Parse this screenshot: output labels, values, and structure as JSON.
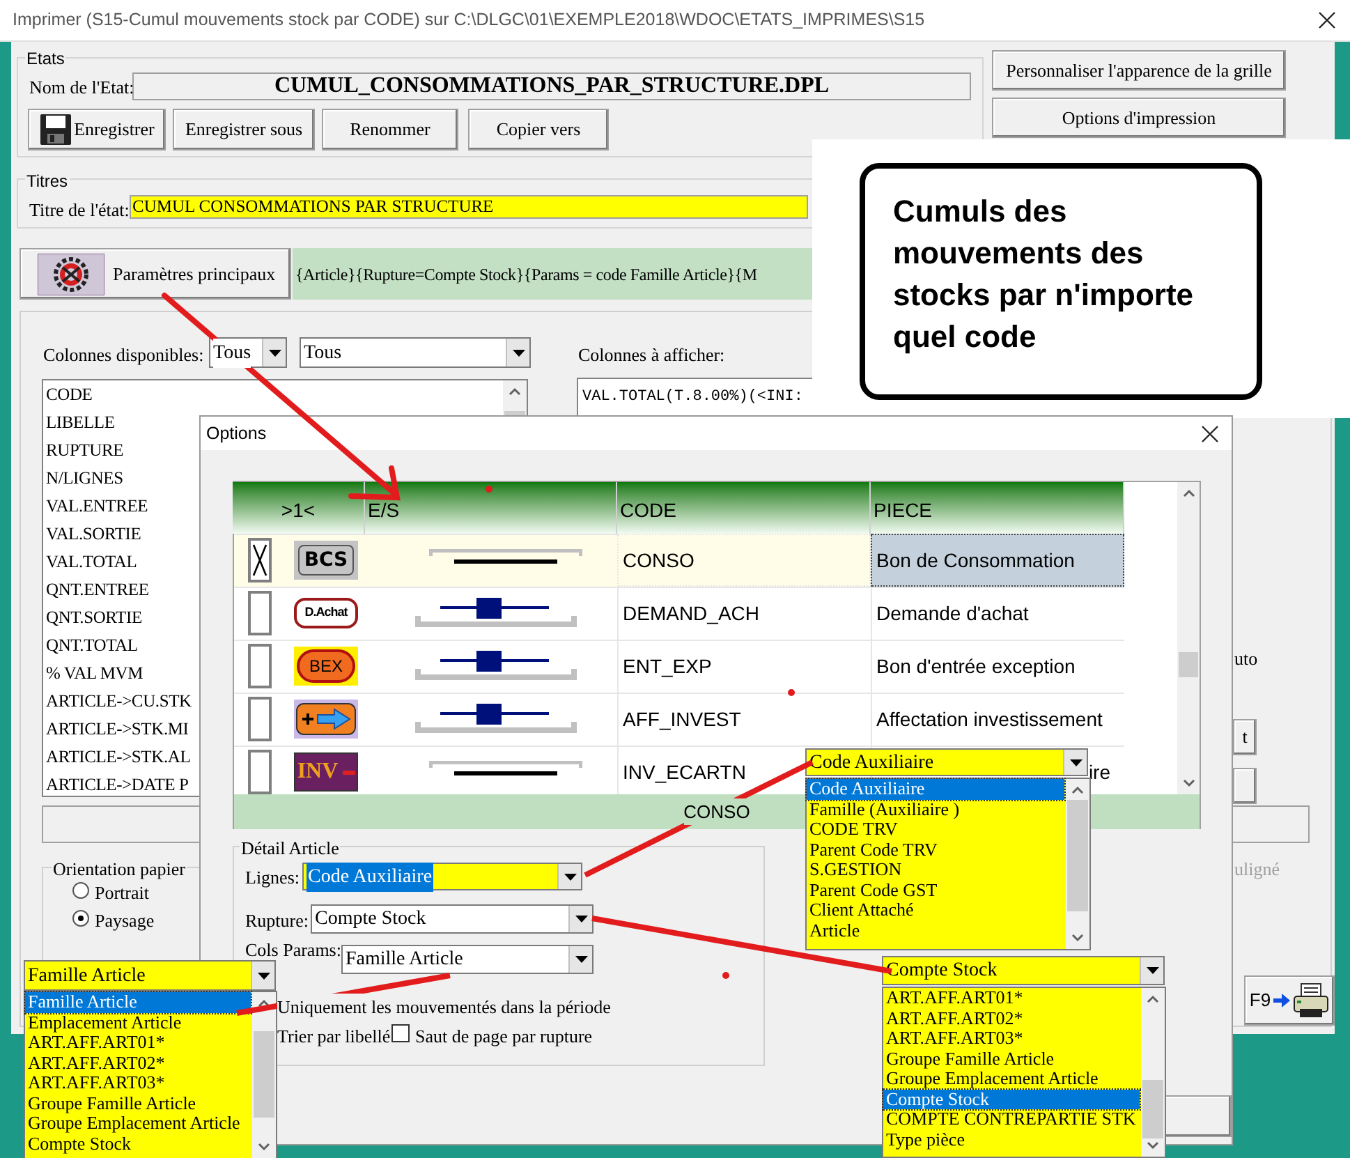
{
  "window": {
    "title": "Imprimer (S15-Cumul mouvements stock par CODE)  sur C:\\DLGC\\01\\EXEMPLE2018\\WDOC\\ETATS_IMPRIMES\\S15"
  },
  "etats": {
    "label": "Etats",
    "name_label": "Nom de l'Etat:",
    "name": "CUMUL_CONSOMMATIONS_PAR_STRUCTURE.DPL",
    "buttons": [
      {
        "label": "Enregistrer",
        "kind": "save"
      },
      {
        "label": "Enregistrer sous",
        "kind": "plain"
      },
      {
        "label": "Renommer",
        "kind": "plain"
      },
      {
        "label": "Copier vers",
        "kind": "plain"
      }
    ]
  },
  "side_buttons": [
    "Personnaliser l'apparence de la grille",
    "Options d'impression"
  ],
  "titres": {
    "label": "Titres",
    "title_label": "Titre de l'état:",
    "title": "CUMUL CONSOMMATIONS PAR STRUCTURE"
  },
  "params": {
    "button": "Paramètres principaux",
    "summary": "{Article}{Rupture=Compte Stock}{Params = code Famille Article}{M"
  },
  "callout": "Cumuls des mouvements des stocks par n'importe quel code",
  "columns": {
    "available_label": "Colonnes disponibles:",
    "filter_1": "Tous",
    "filter_2": "Tous",
    "display_label": "Colonnes à afficher:",
    "available": [
      "CODE",
      "LIBELLE",
      "RUPTURE",
      "N/LIGNES",
      "VAL.ENTREE",
      "VAL.SORTIE",
      "VAL.TOTAL",
      "QNT.ENTREE",
      "QNT.SORTIE",
      "QNT.TOTAL",
      "% VAL MVM",
      "ARTICLE->CU.STK",
      "ARTICLE->STK.MI",
      "ARTICLE->STK.AL",
      "ARTICLE->DATE P"
    ],
    "displayed": [
      "VAL.TOTAL(T.8.00%)(<INI:"
    ]
  },
  "orientation": {
    "label": "Orientation papier",
    "options": [
      {
        "label": "Portrait",
        "selected": false
      },
      {
        "label": "Paysage",
        "selected": true
      }
    ]
  },
  "right_edge": [
    {
      "kind": "text",
      "text": "uto"
    },
    {
      "kind": "button",
      "text": "t"
    },
    {
      "kind": "disabled",
      "text": "uligné"
    }
  ],
  "print_button": {
    "label": "F9"
  },
  "options_dialog": {
    "title": "Options",
    "grid": {
      "columns": [
        ">1<",
        "E/S",
        "CODE",
        "PIECE"
      ],
      "rows": [
        {
          "checked": true,
          "selected": true,
          "kind": "bcs",
          "badge_text": "BCS",
          "es_slider": false,
          "code": "CONSO",
          "piece": "Bon de Consommation"
        },
        {
          "checked": false,
          "selected": false,
          "kind": "dachat",
          "badge_text": "D.Achat",
          "es_slider": true,
          "code": "DEMAND_ACH",
          "piece": "Demande d'achat"
        },
        {
          "checked": false,
          "selected": false,
          "kind": "bex",
          "badge_text": "BEX",
          "es_slider": true,
          "code": "ENT_EXP",
          "piece": "Bon d'entrée exception"
        },
        {
          "checked": false,
          "selected": false,
          "kind": "aff",
          "es_slider": true,
          "code": "AFF_INVEST",
          "piece": "Affectation investissement"
        },
        {
          "checked": false,
          "selected": false,
          "kind": "inv",
          "badge_text": "INV",
          "es_slider": false,
          "code": "INV_ECARTN",
          "piece": "ire"
        }
      ],
      "footer": "CONSO"
    },
    "detail": {
      "label": "Détail Article",
      "fields": [
        {
          "label": "Lignes:",
          "value": "Code Auxiliaire",
          "highlighted": true
        },
        {
          "label": "Rupture:",
          "value": "Compte Stock",
          "highlighted": false
        },
        {
          "label": "Cols Params:",
          "value": "Famille Article",
          "highlighted": false
        }
      ],
      "checks": [
        {
          "label": "Uniquement les mouvementés dans la période"
        },
        {
          "label": "Trier par libellé"
        },
        {
          "label": "Saut de page par rupture",
          "checked": false
        }
      ]
    }
  },
  "open_lists": [
    {
      "value": "Code Auxiliaire",
      "items": [
        {
          "label": "Code Auxiliaire",
          "selected": true
        },
        {
          "label": "Famille (Auxiliaire )",
          "selected": false
        },
        {
          "label": "CODE TRV",
          "selected": false
        },
        {
          "label": "Parent Code TRV",
          "selected": false
        },
        {
          "label": "S.GESTION",
          "selected": false
        },
        {
          "label": "Parent Code GST",
          "selected": false
        },
        {
          "label": "Client Attaché",
          "selected": false
        },
        {
          "label": "Article",
          "selected": false
        }
      ]
    },
    {
      "value": "Famille Article",
      "items": [
        {
          "label": "Famille Article",
          "selected": true
        },
        {
          "label": "Emplacement Article",
          "selected": false
        },
        {
          "label": "ART.AFF.ART01*",
          "selected": false
        },
        {
          "label": "ART.AFF.ART02*",
          "selected": false
        },
        {
          "label": "ART.AFF.ART03*",
          "selected": false
        },
        {
          "label": "Groupe Famille Article",
          "selected": false
        },
        {
          "label": "Groupe Emplacement Article",
          "selected": false
        },
        {
          "label": "Compte Stock",
          "selected": false
        }
      ]
    },
    {
      "value": "Compte Stock",
      "items": [
        {
          "label": "ART.AFF.ART01*",
          "selected": false
        },
        {
          "label": "ART.AFF.ART02*",
          "selected": false
        },
        {
          "label": "ART.AFF.ART03*",
          "selected": false
        },
        {
          "label": "Groupe Famille Article",
          "selected": false
        },
        {
          "label": "Groupe Emplacement Article",
          "selected": false
        },
        {
          "label": "Compte Stock",
          "selected": true
        },
        {
          "label": "COMPTE CONTREPARTIE STK",
          "selected": false
        },
        {
          "label": "Type pièce",
          "selected": false
        }
      ]
    }
  ]
}
